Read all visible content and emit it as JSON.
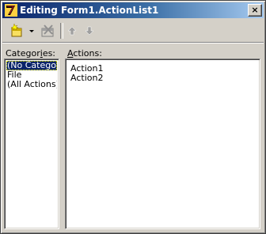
{
  "window": {
    "title": "Editing Form1.ActionList1",
    "close_glyph": "×"
  },
  "toolbar": {
    "new_action_icon": "new-action-icon",
    "dropdown_icon": "dropdown-arrow-icon",
    "delete_icon": "delete-icon",
    "move_up_icon": "arrow-up-icon",
    "move_down_icon": "arrow-down-icon"
  },
  "categories": {
    "label_accel": "Categor",
    "label_u": "i",
    "label_rest": "es:",
    "items": [
      "(No Category)",
      "File",
      "(All Actions)"
    ],
    "selected_index": 0
  },
  "actions": {
    "label_u": "A",
    "label_rest": "ctions:",
    "items": [
      "Action1",
      "Action2"
    ]
  },
  "colors": {
    "face": "#d4d0c8",
    "title_start": "#0a246a",
    "title_end": "#a6caf0",
    "selection": "#0a246a"
  }
}
